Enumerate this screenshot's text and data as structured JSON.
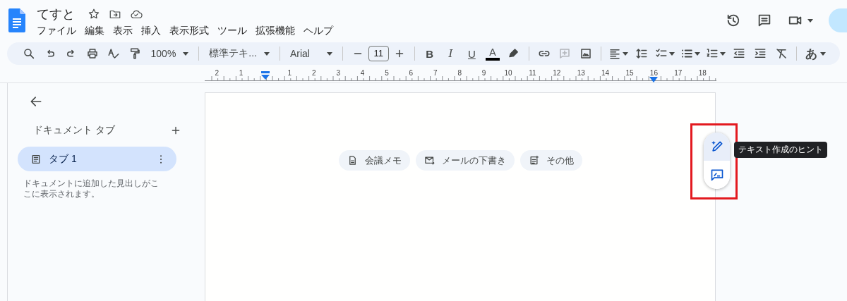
{
  "document": {
    "title": "てすと"
  },
  "menu": [
    "ファイル",
    "編集",
    "表示",
    "挿入",
    "表示形式",
    "ツール",
    "拡張機能",
    "ヘルプ"
  ],
  "toolbar": {
    "zoom": "100%",
    "style": "標準テキ...",
    "font": "Arial",
    "font_size": "11",
    "bold": "B",
    "italic": "I",
    "underline": "U",
    "text_color": "A",
    "add_comment_disabled": true,
    "input_tool": "あ"
  },
  "ruler": {
    "left_labels": [
      "2",
      "1"
    ],
    "right_labels": [
      "1",
      "2",
      "3",
      "4",
      "5",
      "6",
      "7",
      "8",
      "9",
      "10",
      "11",
      "12",
      "13",
      "14",
      "15",
      "16",
      "17",
      "18"
    ]
  },
  "sidebar": {
    "heading": "ドキュメント タブ",
    "tabs": [
      {
        "label": "タブ 1",
        "selected": true
      }
    ],
    "note": "ドキュメントに追加した見出しがここに表示されます。"
  },
  "chips": [
    {
      "kind": "meeting",
      "label": "会議メモ"
    },
    {
      "kind": "email",
      "label": "メールの下書き"
    },
    {
      "kind": "more",
      "label": "その他"
    }
  ],
  "assist": {
    "tooltip": "テキスト作成のヒント",
    "buttons": [
      {
        "kind": "write",
        "selected": true
      },
      {
        "kind": "feedback",
        "selected": false
      }
    ]
  }
}
